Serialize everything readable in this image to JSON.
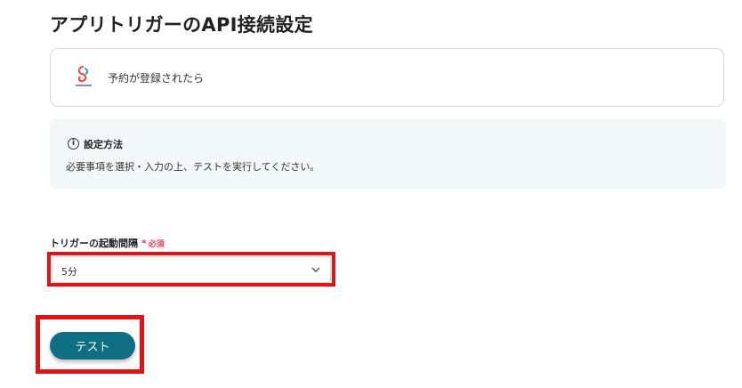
{
  "page": {
    "title": "アプリトリガーのAPI接続設定"
  },
  "trigger": {
    "icon": "app-logo-icon",
    "label": "予約が登録されたら"
  },
  "info": {
    "icon": "info-icon",
    "title": "設定方法",
    "description": "必要事項を選択・入力の上、テストを実行してください。"
  },
  "form": {
    "interval_label": "トリガーの起動間隔",
    "required_mark": "*",
    "required_text": "必須",
    "interval_value": "5分"
  },
  "actions": {
    "test_label": "テスト"
  },
  "colors": {
    "accent": "#106e82",
    "highlight": "#e01414",
    "required": "#e0405a",
    "info_bg": "#f2f8f7"
  }
}
